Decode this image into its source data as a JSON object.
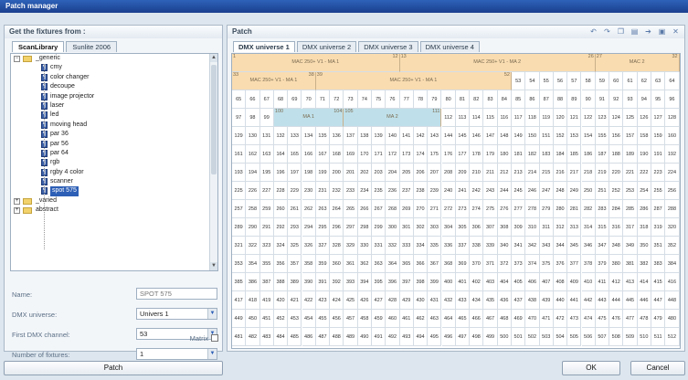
{
  "window": {
    "title": "Patch manager"
  },
  "left_panel": {
    "header": "Get the fixtures from :",
    "tabs": [
      "ScanLibrary",
      "Sunlite 2006"
    ],
    "tree": [
      {
        "label": "_generic",
        "kind": "folder",
        "expanded": true
      },
      {
        "label": "cmy",
        "kind": "fixture"
      },
      {
        "label": "color changer",
        "kind": "fixture"
      },
      {
        "label": "decoupe",
        "kind": "fixture"
      },
      {
        "label": "image projector",
        "kind": "fixture"
      },
      {
        "label": "laser",
        "kind": "fixture"
      },
      {
        "label": "led",
        "kind": "fixture"
      },
      {
        "label": "moving head",
        "kind": "fixture"
      },
      {
        "label": "par 36",
        "kind": "fixture"
      },
      {
        "label": "par 56",
        "kind": "fixture"
      },
      {
        "label": "par 64",
        "kind": "fixture"
      },
      {
        "label": "rgb",
        "kind": "fixture"
      },
      {
        "label": "rgby 4 color",
        "kind": "fixture"
      },
      {
        "label": "scanner",
        "kind": "fixture"
      },
      {
        "label": "spot 575",
        "kind": "fixture",
        "selected": true
      },
      {
        "label": "_varied",
        "kind": "folder"
      },
      {
        "label": "abstract",
        "kind": "folder"
      }
    ],
    "form": {
      "name_label": "Name:",
      "name_value": "SPOT 575",
      "universe_label": "DMX universe:",
      "universe_value": "Univers 1",
      "channel_label": "First DMX channel:",
      "channel_value": "53",
      "count_label": "Number of fixtures:",
      "count_value": "1",
      "matrix_label": "Matrix"
    },
    "patch_button": "Patch"
  },
  "right_panel": {
    "header": "Patch",
    "universe_tabs": [
      "DMX universe 1",
      "DMX universe 2",
      "DMX universe 3",
      "DMX universe 4"
    ],
    "fixtures": [
      {
        "name": "MAC 250+ V1 - MA 1",
        "start": 1,
        "end": 12,
        "color": "#f9dcb0"
      },
      {
        "name": "MAC 250+ V1 - MA 2",
        "start": 13,
        "end": 26,
        "color": "#f9dcb0"
      },
      {
        "name": "MAC 2",
        "start": 27,
        "end": 32,
        "color": "#f9dcb0"
      },
      {
        "name": "MAC 250+ V1 - MA 1",
        "start": 33,
        "end": 38,
        "color": "#f9dcb0"
      },
      {
        "name": "MAC 250+ V1 - MA 1",
        "start": 39,
        "end": 52,
        "color": "#f9dcb0"
      },
      {
        "name": "MA 1",
        "start": 100,
        "end": 104,
        "color": "#bfe0ea"
      },
      {
        "name": "MA 2",
        "start": 105,
        "end": 111,
        "color": "#bfe0ea"
      }
    ],
    "grid": {
      "columns": 32,
      "rows": 16,
      "max_channel": 512
    }
  },
  "buttons": {
    "ok": "OK",
    "cancel": "Cancel"
  }
}
